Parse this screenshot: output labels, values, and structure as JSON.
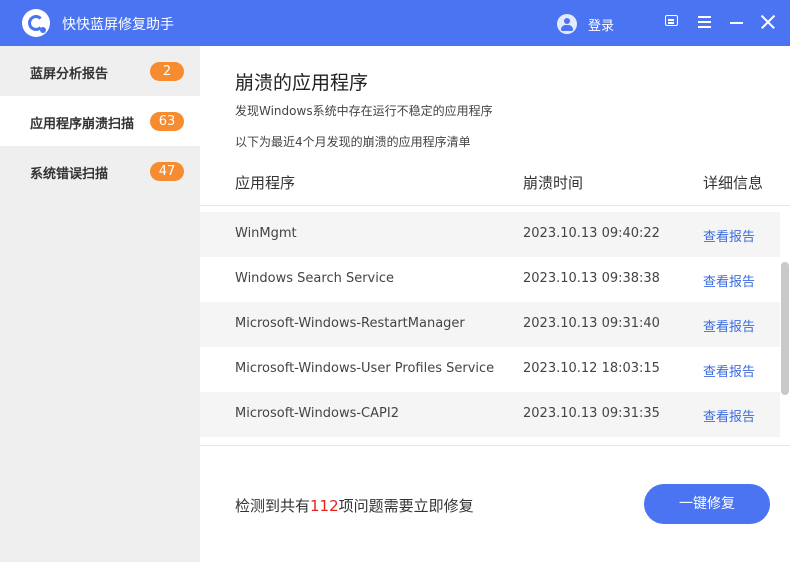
{
  "app": {
    "title": "快快蓝屏修复助手",
    "login_label": "登录"
  },
  "sidebar": {
    "items": [
      {
        "label": "蓝屏分析报告",
        "badge": "2"
      },
      {
        "label": "应用程序崩溃扫描",
        "badge": "63"
      },
      {
        "label": "系统错误扫描",
        "badge": "47"
      }
    ]
  },
  "main": {
    "title": "崩溃的应用程序",
    "description": "发现Windows系统中存在运行不稳定的应用程序",
    "subdescription": "以下为最近4个月发现的崩溃的应用程序清单",
    "columns": {
      "app": "应用程序",
      "time": "崩溃时间",
      "detail": "详细信息"
    },
    "rows": [
      {
        "app": "WinMgmt",
        "time": "2023.10.13 09:40:22",
        "link": "查看报告"
      },
      {
        "app": "Windows Search Service",
        "time": "2023.10.13 09:38:38",
        "link": "查看报告"
      },
      {
        "app": "Microsoft-Windows-RestartManager",
        "time": "2023.10.13 09:31:40",
        "link": "查看报告"
      },
      {
        "app": "Microsoft-Windows-User Profiles Service",
        "time": "2023.10.12 18:03:15",
        "link": "查看报告"
      },
      {
        "app": "Microsoft-Windows-CAPI2",
        "time": "2023.10.13 09:31:35",
        "link": "查看报告"
      }
    ]
  },
  "footer": {
    "summary_prefix": "检测到共有",
    "summary_count": "112",
    "summary_suffix": "项问题需要立即修复",
    "fix_button": "一键修复"
  },
  "colors": {
    "accent": "#4a74f1",
    "badge": "#f68c2f",
    "count_highlight": "#e3231e",
    "link": "#3c6be0"
  },
  "icons": {
    "logo": "app-logo-icon",
    "user": "user-icon",
    "feedback": "feedback-icon",
    "menu": "menu-icon",
    "minimize": "minimize-icon",
    "close": "close-icon"
  }
}
